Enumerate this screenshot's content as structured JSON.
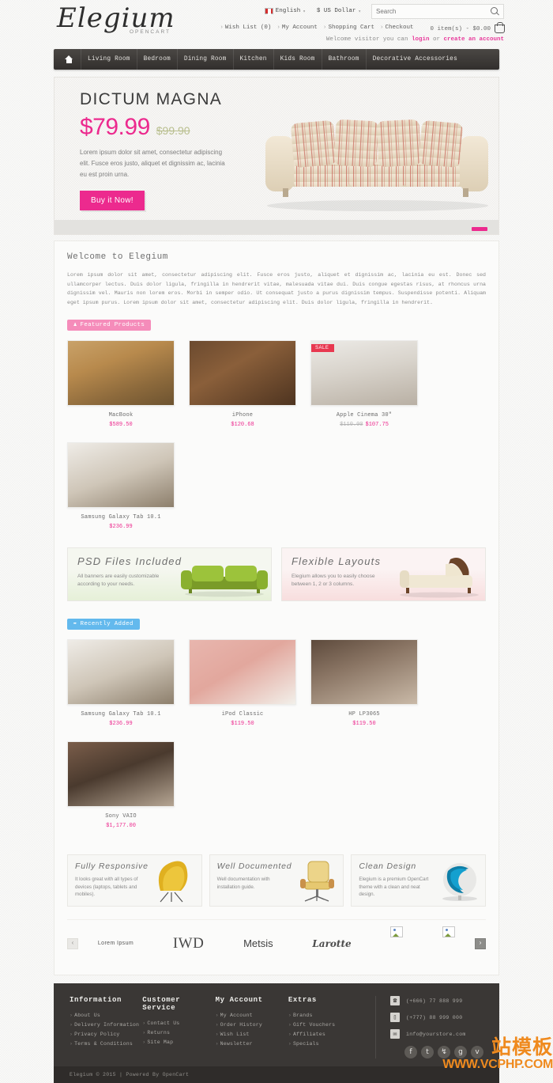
{
  "topbar": {
    "language": "English",
    "currency": "$ US Dollar",
    "search_placeholder": "Search",
    "links": [
      "Wish List (0)",
      "My Account",
      "Shopping Cart",
      "Checkout"
    ],
    "cart_total": "0 item(s) - $0.00",
    "welcome_prefix": "Welcome visitor you can ",
    "login_label": "login",
    "welcome_or": " or ",
    "register_label": "create an account"
  },
  "logo": {
    "name": "Elegium",
    "sub": "OPENCART"
  },
  "nav": {
    "home_label": "Home",
    "items": [
      "Living Room",
      "Bedroom",
      "Dining Room",
      "Kitchen",
      "Kids Room",
      "Bathroom",
      "Decorative Accessories"
    ]
  },
  "hero": {
    "title": "DICTUM MAGNA",
    "price": "$79.99",
    "old_price": "$99.90",
    "description": "Lorem ipsum dolor sit amet, consectetur adipiscing elit. Fusce eros justo, aliquet et dignissim ac, lacinia eu est proin urna.",
    "button": "Buy it Now!"
  },
  "welcome": {
    "heading": "Welcome to Elegium",
    "body": "Lorem ipsum dolor sit amet, consectetur adipiscing elit. Fusce eros justo, aliquet et dignissim ac, lacinia eu est. Donec sed ullamcorper lectus. Duis dolor ligula, fringilla in hendrerit vitae, malesuada vitae dui. Duis congue egestas risus, at rhoncus urna dignissim vel. Mauris non lorem eros. Morbi in semper odio. Ut consequat justo a purus dignissim tempus. Suspendisse potenti. Aliquam eget ipsum purus. Lorem ipsum dolor sit amet, consectetur adipiscing elit. Duis dolor ligula, fringilla in hendrerit."
  },
  "featured": {
    "badge": "Featured Products",
    "badge_icon": "trophy-icon",
    "products": [
      {
        "name": "MacBook",
        "price": "$589.50",
        "old_price": "",
        "sale": false,
        "thumb_class": "room-a"
      },
      {
        "name": "iPhone",
        "price": "$120.68",
        "old_price": "",
        "sale": false,
        "thumb_class": "room-b"
      },
      {
        "name": "Apple Cinema 30\"",
        "price": "$107.75",
        "old_price": "$110.00",
        "sale": true,
        "sale_label": "SALE",
        "thumb_class": "room-c"
      },
      {
        "name": "Samsung Galaxy Tab 10.1",
        "price": "$236.99",
        "old_price": "",
        "sale": false,
        "thumb_class": "room-d"
      }
    ]
  },
  "banners": [
    {
      "title": "PSD Files Included",
      "text": "All banners are easily customizable according to your needs.",
      "style": "green"
    },
    {
      "title": "Flexible Layouts",
      "text": "Elegium allows you to easily choose between 1, 2 or 3 columns.",
      "style": "pink"
    }
  ],
  "recent": {
    "badge": "Recently Added",
    "badge_icon": "arrow-right-icon",
    "products": [
      {
        "name": "Samsung Galaxy Tab 10.1",
        "price": "$236.99",
        "thumb_class": "room-d"
      },
      {
        "name": "iPod Classic",
        "price": "$119.50",
        "thumb_class": "room-e"
      },
      {
        "name": "HP LP3065",
        "price": "$119.50",
        "thumb_class": "room-f"
      },
      {
        "name": "Sony VAIO",
        "price": "$1,177.00",
        "thumb_class": "room-g"
      }
    ]
  },
  "features": [
    {
      "title": "Fully Responsive",
      "text": "It looks great with all types of devices (laptops, tablets and mobiles)."
    },
    {
      "title": "Well Documented",
      "text": "Well documentation with installation guide."
    },
    {
      "title": "Clean Design",
      "text": "Elegium is a premium OpenCart theme with a clean and neat design."
    }
  ],
  "brands": {
    "prev_icon": "chevron-left-icon",
    "next_icon": "chevron-right-icon",
    "items": [
      "Lorem Ipsum",
      "IWD",
      "Metsis",
      "Larotte"
    ]
  },
  "footer": {
    "columns": [
      {
        "heading": "Information",
        "links": [
          "About Us",
          "Delivery Information",
          "Privacy Policy",
          "Terms & Conditions"
        ]
      },
      {
        "heading": "Customer Service",
        "links": [
          "Contact Us",
          "Returns",
          "Site Map"
        ]
      },
      {
        "heading": "My Account",
        "links": [
          "My Account",
          "Order History",
          "Wish List",
          "Newsletter"
        ]
      },
      {
        "heading": "Extras",
        "links": [
          "Brands",
          "Gift Vouchers",
          "Affiliates",
          "Specials"
        ]
      }
    ],
    "contacts": [
      {
        "icon": "phone-icon",
        "glyph": "☎",
        "text": "(+666) 77 888 999"
      },
      {
        "icon": "mobile-icon",
        "glyph": "▯",
        "text": "(+777) 88 999 000"
      },
      {
        "icon": "mail-icon",
        "glyph": "✉",
        "text": "info@yourstore.com"
      }
    ],
    "socials": [
      {
        "icon": "facebook-icon",
        "glyph": "f"
      },
      {
        "icon": "twitter-icon",
        "glyph": "t"
      },
      {
        "icon": "rss-icon",
        "glyph": "↯"
      },
      {
        "icon": "google-plus-icon",
        "glyph": "g"
      },
      {
        "icon": "vimeo-icon",
        "glyph": "v"
      }
    ],
    "copyright": "Elegium © 2015 | Powered By OpenCart"
  },
  "watermark": {
    "cn": "站模板",
    "url": "WWW.VCPHP.COM"
  },
  "colors": {
    "accent_pink": "#ec2a8e",
    "badge_pink": "#f58cba",
    "badge_blue": "#63b9ed",
    "nav_dark": "#3a3735",
    "sale_red": "#e8384f"
  }
}
